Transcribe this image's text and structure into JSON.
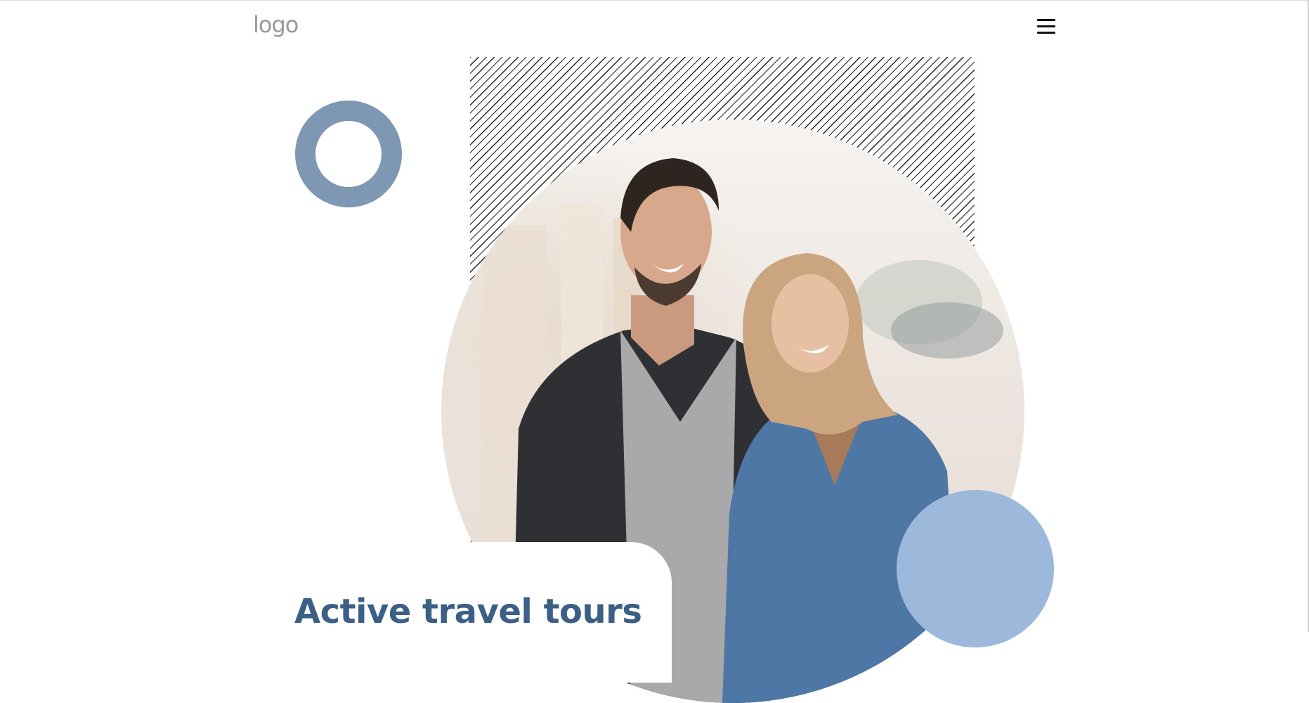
{
  "header": {
    "logo_text": "logo",
    "menu_icon": "hamburger-menu-icon"
  },
  "hero": {
    "heading": "Active travel tours",
    "photo_description_icon": "couple-photo",
    "decor": {
      "ring_color": "#7e97b3",
      "dot_color": "#9cb9dc",
      "heading_color": "#3c5f86"
    }
  }
}
